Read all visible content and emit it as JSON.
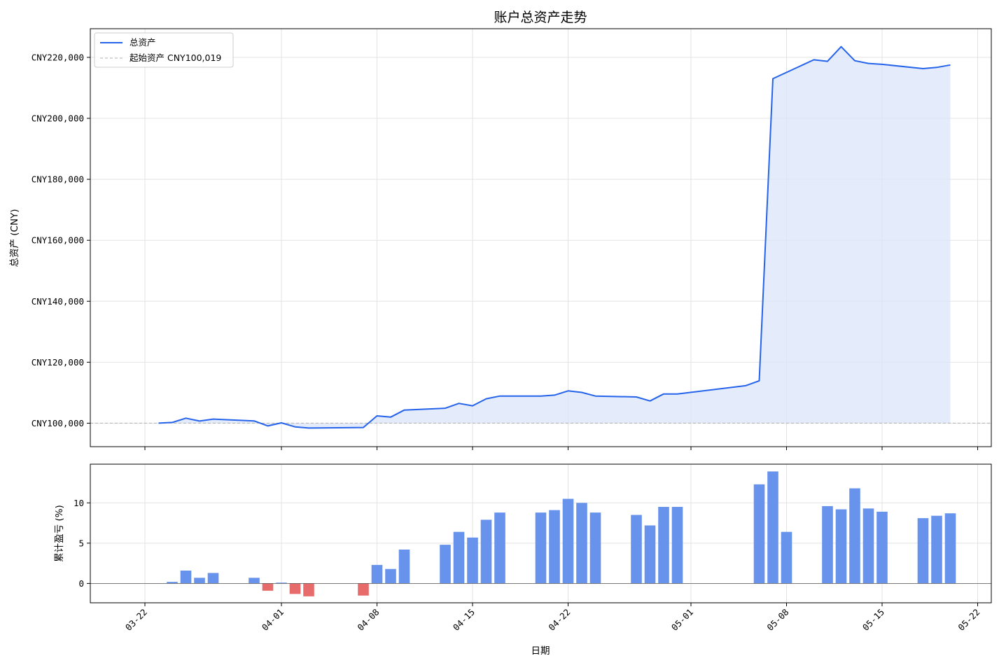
{
  "chart_data": [
    {
      "type": "area",
      "title": "账户总资产走势",
      "ylabel": "总资产 (CNY)",
      "xlabel": "",
      "ylim": [
        92300,
        229400
      ],
      "xlim": [
        "2025-03-18",
        "2025-05-23"
      ],
      "y_ticks": [
        100000,
        120000,
        140000,
        160000,
        180000,
        200000,
        220000
      ],
      "y_tick_labels": [
        "CNY100,000",
        "CNY120,000",
        "CNY140,000",
        "CNY160,000",
        "CNY180,000",
        "CNY200,000",
        "CNY220,000"
      ],
      "grid": true,
      "legend_position": "top-left",
      "colors": {
        "line": "#2563eb",
        "fill": "#dbe6f9",
        "baseline": "#b0b0b0"
      },
      "series": [
        {
          "name": "总资产",
          "x": [
            "2025-03-23",
            "2025-03-24",
            "2025-03-25",
            "2025-03-26",
            "2025-03-27",
            "2025-03-30",
            "2025-03-31",
            "2025-04-01",
            "2025-04-02",
            "2025-04-03",
            "2025-04-07",
            "2025-04-08",
            "2025-04-09",
            "2025-04-10",
            "2025-04-13",
            "2025-04-14",
            "2025-04-15",
            "2025-04-16",
            "2025-04-17",
            "2025-04-20",
            "2025-04-21",
            "2025-04-22",
            "2025-04-23",
            "2025-04-24",
            "2025-04-27",
            "2025-04-28",
            "2025-04-29",
            "2025-04-30",
            "2025-05-05",
            "2025-05-06",
            "2025-05-07",
            "2025-05-10",
            "2025-05-11",
            "2025-05-12",
            "2025-05-13",
            "2025-05-14",
            "2025-05-15",
            "2025-05-18",
            "2025-05-19",
            "2025-05-20"
          ],
          "values": [
            100019,
            100250,
            101650,
            100700,
            101350,
            100750,
            99100,
            100100,
            98800,
            98400,
            98600,
            102400,
            102000,
            104300,
            104900,
            106500,
            105700,
            108000,
            108900,
            108900,
            109200,
            110600,
            110100,
            108900,
            108600,
            107300,
            109600,
            109600,
            112300,
            113900,
            213000,
            219200,
            218700,
            223500,
            218900,
            218000,
            217700,
            216300,
            216700,
            217500
          ]
        },
        {
          "name": "起始资产 CNY100,019",
          "value": 100019
        }
      ]
    },
    {
      "type": "bar",
      "ylabel": "累计盈亏 (%)",
      "xlabel": "日期",
      "ylim": [
        -2.4,
        14.8
      ],
      "y_ticks": [
        0,
        5,
        10
      ],
      "y_tick_labels": [
        "0",
        "5",
        "10"
      ],
      "x_ticks": [
        "03-22",
        "04-01",
        "04-08",
        "04-15",
        "04-22",
        "05-01",
        "05-08",
        "05-15",
        "05-22"
      ],
      "grid": true,
      "colors": {
        "positive": "#6793ed",
        "negative": "#e86b6b",
        "zero_line": "#555555"
      },
      "x": [
        "2025-03-24",
        "2025-03-25",
        "2025-03-26",
        "2025-03-27",
        "2025-03-30",
        "2025-03-31",
        "2025-04-01",
        "2025-04-02",
        "2025-04-03",
        "2025-04-07",
        "2025-04-08",
        "2025-04-09",
        "2025-04-10",
        "2025-04-13",
        "2025-04-14",
        "2025-04-15",
        "2025-04-16",
        "2025-04-17",
        "2025-04-20",
        "2025-04-21",
        "2025-04-22",
        "2025-04-23",
        "2025-04-24",
        "2025-04-27",
        "2025-04-28",
        "2025-04-29",
        "2025-04-30",
        "2025-05-06",
        "2025-05-07",
        "2025-05-08",
        "2025-05-11",
        "2025-05-12",
        "2025-05-13",
        "2025-05-14",
        "2025-05-15",
        "2025-05-18",
        "2025-05-19",
        "2025-05-20"
      ],
      "values": [
        0.2,
        1.6,
        0.7,
        1.3,
        0.7,
        -0.9,
        0.1,
        -1.3,
        -1.6,
        -1.5,
        2.3,
        1.8,
        4.2,
        4.8,
        6.4,
        5.7,
        7.9,
        8.8,
        8.8,
        9.1,
        10.5,
        10.0,
        8.8,
        8.5,
        7.2,
        9.5,
        9.5,
        12.3,
        13.9,
        6.4,
        9.6,
        9.2,
        11.8,
        9.3,
        8.9,
        8.1,
        8.4,
        8.7
      ]
    }
  ]
}
